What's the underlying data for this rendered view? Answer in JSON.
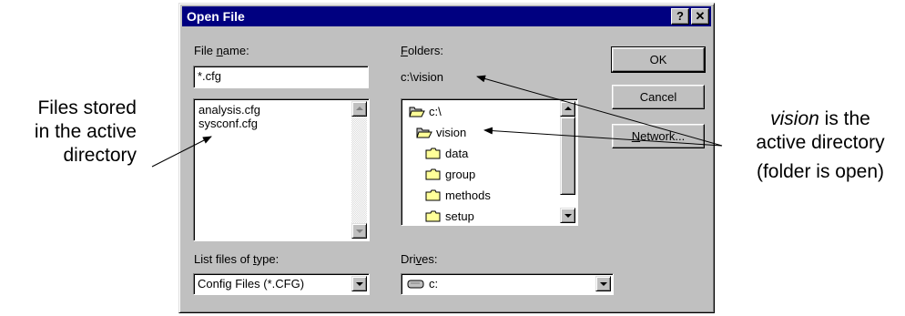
{
  "annotations": {
    "left_lines": [
      "Files stored",
      "in the active",
      "directory"
    ],
    "right_word": "vision",
    "right_rest": " is the",
    "right_line2": "active directory",
    "right_line3": "(folder is open)"
  },
  "dialog": {
    "title": "Open File",
    "help_button": "?",
    "close_button": "✕",
    "file_name": {
      "label_pre": "File ",
      "label_ul": "n",
      "label_post": "ame:",
      "value": "*.cfg",
      "files": [
        "analysis.cfg",
        "sysconf.cfg"
      ]
    },
    "folders": {
      "label_ul": "F",
      "label_post": "olders:",
      "current_path": "c:\\vision",
      "tree": [
        {
          "name": "c:\\",
          "icon": "open-folder-icon"
        },
        {
          "name": "vision",
          "icon": "open-folder-icon"
        },
        {
          "name": "data",
          "icon": "folder-icon"
        },
        {
          "name": "group",
          "icon": "folder-icon"
        },
        {
          "name": "methods",
          "icon": "folder-icon"
        },
        {
          "name": "setup",
          "icon": "folder-icon"
        }
      ]
    },
    "buttons": {
      "ok": "OK",
      "cancel": "Cancel",
      "network_ul": "N",
      "network_post": "etwork..."
    },
    "file_type": {
      "label_pre": "List files of ",
      "label_ul": "t",
      "label_post": "ype:",
      "value": "Config Files (*.CFG)"
    },
    "drives": {
      "label_pre": "Dri",
      "label_ul": "v",
      "label_post": "es:",
      "value": "c:"
    }
  },
  "colors": {
    "titlebar": "#000080",
    "face": "#c0c0c0",
    "folder": "#ffff99"
  }
}
